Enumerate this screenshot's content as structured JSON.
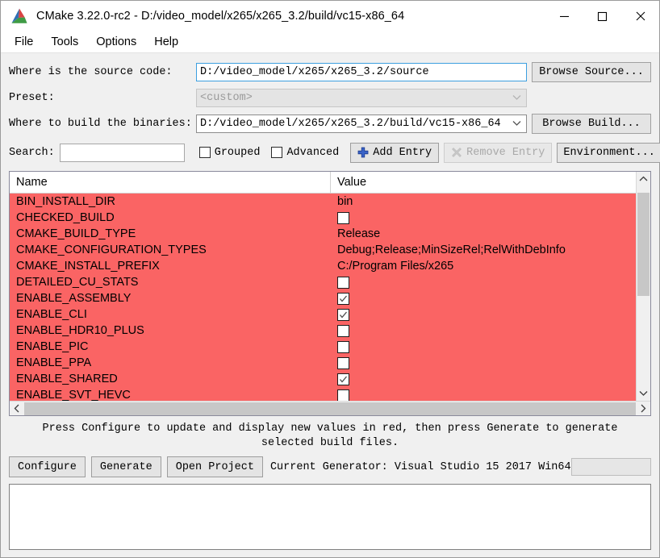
{
  "window": {
    "title": "CMake 3.22.0-rc2 - D:/video_model/x265/x265_3.2/build/vc15-x86_64",
    "logo_icon": "cmake-logo-icon",
    "minimize_icon": "minimize-icon",
    "maximize_icon": "maximize-icon",
    "close_icon": "close-icon"
  },
  "menubar": {
    "items": [
      {
        "label": "File"
      },
      {
        "label": "Tools"
      },
      {
        "label": "Options"
      },
      {
        "label": "Help"
      }
    ]
  },
  "form": {
    "source_label": "Where is the source code:",
    "source_value": "D:/video_model/x265/x265_3.2/source",
    "browse_source_label": "Browse Source...",
    "preset_label": "Preset:",
    "preset_value": "<custom>",
    "binaries_label": "Where to build the binaries:",
    "binaries_value": "D:/video_model/x265/x265_3.2/build/vc15-x86_64",
    "browse_build_label": "Browse Build...",
    "chevron_icon": "chevron-down-icon"
  },
  "search": {
    "label": "Search:",
    "value": "",
    "placeholder": "",
    "grouped_label": "Grouped",
    "grouped_checked": false,
    "advanced_label": "Advanced",
    "advanced_checked": false,
    "add_entry_label": "Add Entry",
    "add_entry_icon": "plus-icon",
    "remove_entry_label": "Remove Entry",
    "remove_entry_icon": "x-remove-icon",
    "remove_entry_enabled": false,
    "environment_label": "Environment..."
  },
  "cache_table": {
    "headers": {
      "name": "Name",
      "value": "Value"
    },
    "row_highlight_color": "#fa6464",
    "rows": [
      {
        "name": "BIN_INSTALL_DIR",
        "type": "text",
        "value": "bin"
      },
      {
        "name": "CHECKED_BUILD",
        "type": "bool",
        "value": false
      },
      {
        "name": "CMAKE_BUILD_TYPE",
        "type": "text",
        "value": "Release"
      },
      {
        "name": "CMAKE_CONFIGURATION_TYPES",
        "type": "text",
        "value": "Debug;Release;MinSizeRel;RelWithDebInfo"
      },
      {
        "name": "CMAKE_INSTALL_PREFIX",
        "type": "text",
        "value": "C:/Program Files/x265"
      },
      {
        "name": "DETAILED_CU_STATS",
        "type": "bool",
        "value": false
      },
      {
        "name": "ENABLE_ASSEMBLY",
        "type": "bool",
        "value": true
      },
      {
        "name": "ENABLE_CLI",
        "type": "bool",
        "value": true
      },
      {
        "name": "ENABLE_HDR10_PLUS",
        "type": "bool",
        "value": false
      },
      {
        "name": "ENABLE_PIC",
        "type": "bool",
        "value": false
      },
      {
        "name": "ENABLE_PPA",
        "type": "bool",
        "value": false
      },
      {
        "name": "ENABLE_SHARED",
        "type": "bool",
        "value": true
      },
      {
        "name": "ENABLE_SVT_HEVC",
        "type": "bool",
        "value": false
      },
      {
        "name": "",
        "type": "bool",
        "value": false
      }
    ],
    "scroll_up_icon": "chevron-up-icon",
    "scroll_down_icon": "chevron-down-icon",
    "scroll_left_icon": "chevron-left-icon",
    "scroll_right_icon": "chevron-right-icon"
  },
  "status": {
    "message": "Press Configure to update and display new values in red, then press Generate to generate selected build files."
  },
  "actions": {
    "configure_label": "Configure",
    "generate_label": "Generate",
    "open_project_label": "Open Project",
    "current_generator": "Current Generator: Visual Studio 15 2017 Win64",
    "progress_value": ""
  },
  "output": {
    "text": ""
  }
}
